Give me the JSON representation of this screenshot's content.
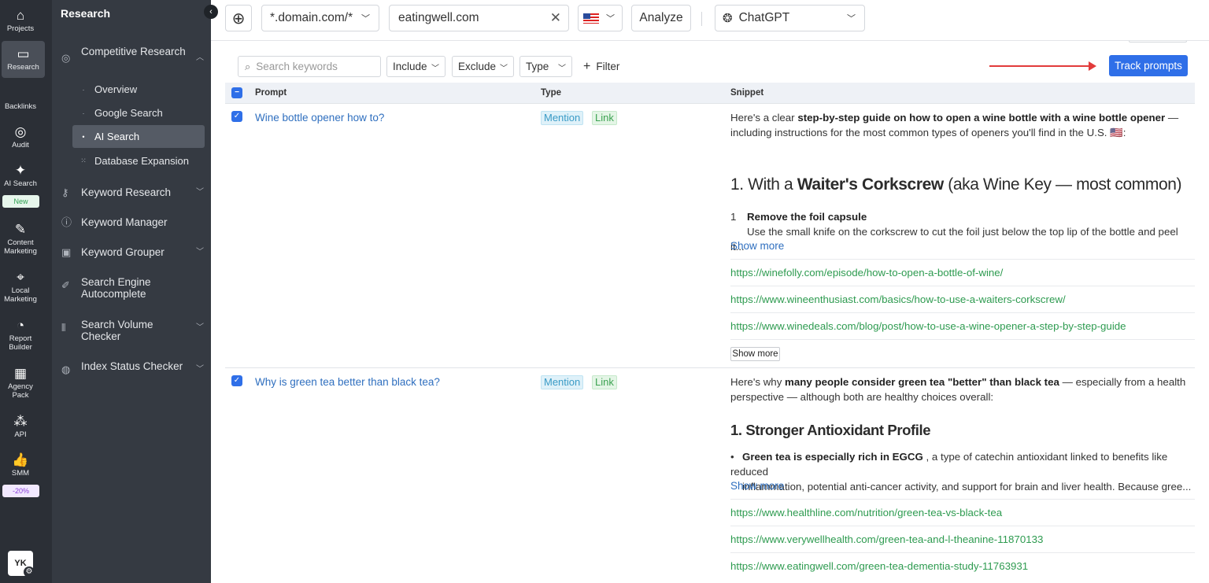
{
  "rail": {
    "items": [
      {
        "label": "Projects",
        "icon": "home-icon"
      },
      {
        "label": "Research",
        "icon": "research-icon"
      },
      {
        "label": "Backlinks",
        "icon": "backlinks-icon"
      },
      {
        "label": "Audit",
        "icon": "audit-icon"
      },
      {
        "label": "AI Search",
        "icon": "sparkle-icon",
        "badge": "New"
      },
      {
        "label": "Content Marketing",
        "icon": "edit-icon"
      },
      {
        "label": "Local Marketing",
        "icon": "pin-icon"
      },
      {
        "label": "Report Builder",
        "icon": "pie-icon"
      },
      {
        "label": "Agency Pack",
        "icon": "building-icon"
      },
      {
        "label": "API",
        "icon": "api-icon"
      },
      {
        "label": "SMM",
        "icon": "thumbs-up-icon",
        "badge": "-20%"
      }
    ],
    "avatar": "YK"
  },
  "sidebar": {
    "title": "Research",
    "competitive": "Competitive Research",
    "sub_items": [
      "Overview",
      "Google Search",
      "AI Search",
      "Database Expansion"
    ],
    "items": [
      {
        "label": "Keyword Research"
      },
      {
        "label": "Keyword Manager"
      },
      {
        "label": "Keyword Grouper"
      },
      {
        "label": "Search Engine Autocomplete"
      },
      {
        "label": "Search Volume Checker"
      },
      {
        "label": "Index Status Checker"
      }
    ]
  },
  "topbar": {
    "scope": "*.domain.com/*",
    "domain": "eatingwell.com",
    "analyze": "Analyze",
    "engine": "ChatGPT"
  },
  "filters": {
    "search_placeholder": "Search keywords",
    "include": "Include",
    "exclude": "Exclude",
    "type": "Type",
    "filter": "Filter",
    "track": "Track prompts"
  },
  "table": {
    "headers": [
      "Prompt",
      "Type",
      "Snippet"
    ],
    "rows": [
      {
        "prompt": "Wine bottle opener how to?",
        "tags": [
          "Mention",
          "Link"
        ],
        "intro_a": "Here's a clear ",
        "intro_b": "step-by-step guide on how to open a wine bottle with a wine bottle opener",
        "intro_c": " —",
        "intro2": "including instructions for the most common types of openers you'll find in the U.S. 🇺🇸:",
        "heading_a": "1. With a ",
        "heading_b": "Waiter's Corkscrew",
        "heading_c": " (aka Wine Key — most common)",
        "step_num": "1",
        "step_title": "Remove the foil capsule",
        "step_text": "Use the small knife on the corkscrew to cut the foil just below the top lip of the bottle and peel it...",
        "show_more": "Show more",
        "urls": [
          "https://winefolly.com/episode/how-to-open-a-bottle-of-wine/",
          "https://www.wineenthusiast.com/basics/how-to-use-a-waiters-corkscrew/",
          "https://www.winedeals.com/blog/post/how-to-use-a-wine-opener-a-step-by-step-guide"
        ],
        "show_more_btn": "Show more"
      },
      {
        "prompt": "Why is green tea better than black tea?",
        "tags": [
          "Mention",
          "Link"
        ],
        "intro_a": "Here's why ",
        "intro_b": "many people consider green tea \"better\" than black tea",
        "intro_c": " — especially from a health",
        "intro2": "perspective — although both are healthy choices overall:",
        "heading": "1. Stronger Antioxidant Profile",
        "bullet_b": "Green tea is especially rich in EGCG",
        "bullet_text": " , a type of catechin antioxidant linked to benefits like reduced",
        "bullet_text2": "inflammation, potential anti-cancer activity, and support for brain and liver health. Because gree...",
        "show_more": "Show more",
        "urls": [
          "https://www.healthline.com/nutrition/green-tea-vs-black-tea",
          "https://www.verywellhealth.com/green-tea-and-l-theanine-11870133",
          "https://www.eatingwell.com/green-tea-dementia-study-11763931"
        ]
      }
    ]
  }
}
